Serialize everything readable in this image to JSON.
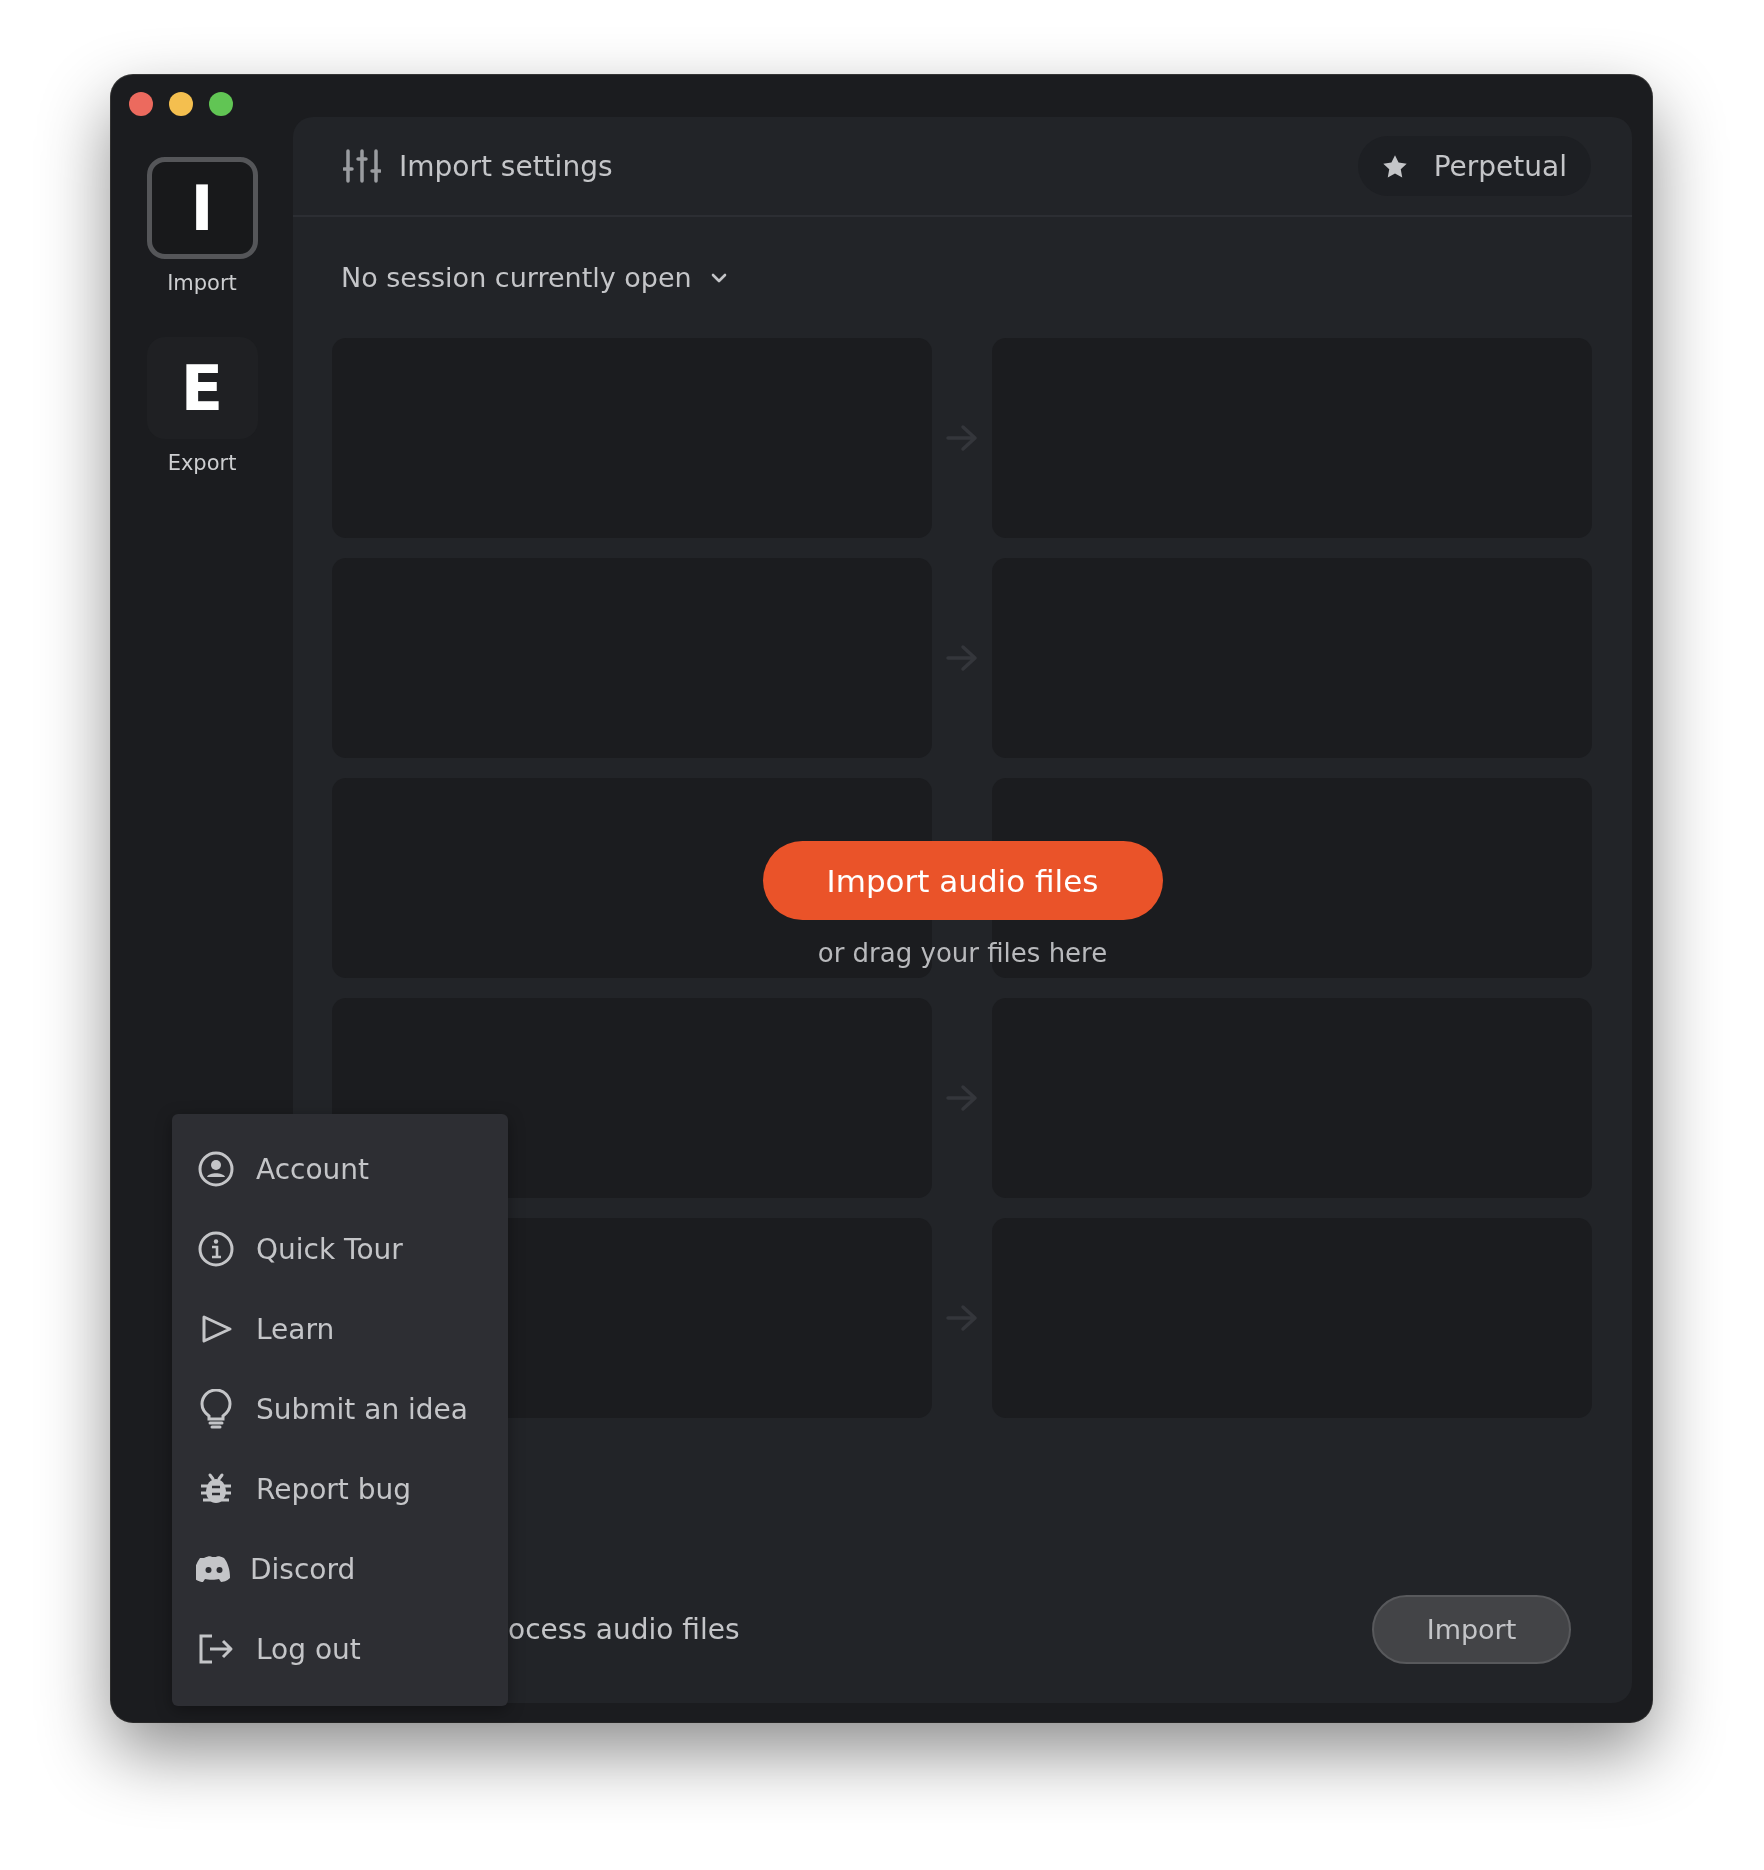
{
  "window": {
    "controls": [
      {
        "color": "#ec6a5e"
      },
      {
        "color": "#f4bf4f"
      },
      {
        "color": "#61c554"
      }
    ]
  },
  "sidebar": {
    "items": [
      {
        "letter": "I",
        "label": "Import",
        "selected": true
      },
      {
        "letter": "E",
        "label": "Export",
        "selected": false
      }
    ]
  },
  "header": {
    "title": "Import settings",
    "plan": "Perpetual"
  },
  "session": {
    "label": "No session currently open"
  },
  "slot_rows": [
    {
      "arrow": true
    },
    {
      "arrow": true
    },
    {
      "arrow": false
    },
    {
      "arrow": true
    },
    {
      "arrow": true
    }
  ],
  "drop": {
    "button": "Import audio files",
    "hint": "or drag your files here"
  },
  "footer": {
    "text": "ocess audio files",
    "button": "Import"
  },
  "menu": {
    "items": [
      {
        "kind": "account",
        "label": "Account"
      },
      {
        "kind": "info",
        "label": "Quick Tour"
      },
      {
        "kind": "play",
        "label": "Learn"
      },
      {
        "kind": "idea",
        "label": "Submit an idea"
      },
      {
        "kind": "bug",
        "label": "Report bug"
      },
      {
        "kind": "discord",
        "label": "Discord"
      },
      {
        "kind": "logout",
        "label": "Log out"
      }
    ]
  }
}
